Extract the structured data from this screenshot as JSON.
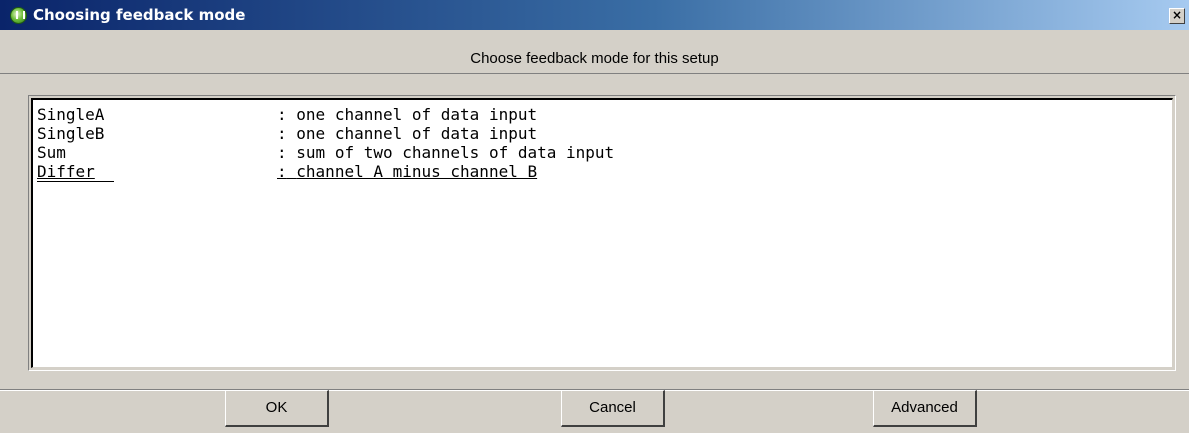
{
  "window": {
    "title": "Choosing feedback mode",
    "close_label": "×"
  },
  "header": {
    "prompt": "Choose feedback mode for this setup"
  },
  "modes": [
    {
      "name": "SingleA",
      "separator": ":",
      "description": "one channel of data input",
      "selected": false
    },
    {
      "name": "SingleB",
      "separator": ":",
      "description": "one channel of data input",
      "selected": false
    },
    {
      "name": "Sum",
      "separator": ":",
      "description": "sum of two channels of data input",
      "selected": false
    },
    {
      "name": "Differ",
      "separator": ":",
      "description": "channel A minus channel B",
      "selected": true
    }
  ],
  "buttons": {
    "ok_label": "OK",
    "cancel_label": "Cancel",
    "advanced_label": "Advanced"
  },
  "colors": {
    "titlebar_start": "#0a246a",
    "titlebar_end": "#a6caf0",
    "dialog_background": "#d4d0c8",
    "list_background": "#ffffff"
  },
  "icons": {
    "app": "app-icon",
    "close": "close-icon"
  }
}
